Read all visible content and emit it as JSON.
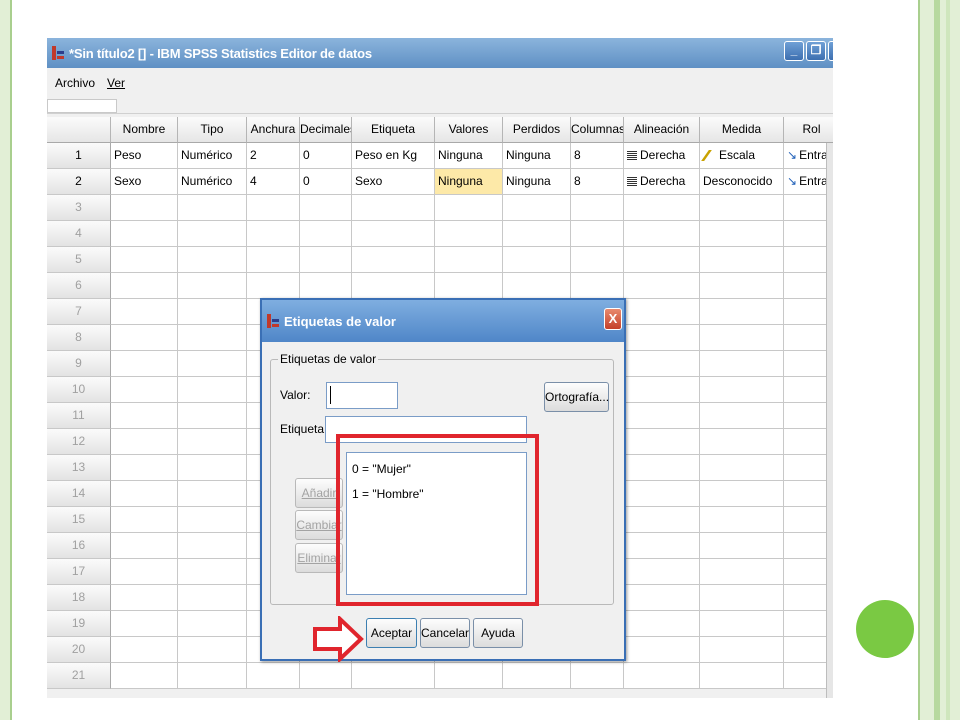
{
  "window": {
    "title": "*Sin título2 [] - IBM SPSS Statistics Editor de datos",
    "minimize_glyph": "_",
    "restore_glyph": "❐",
    "close_glyph": "X"
  },
  "menu": {
    "items": [
      "Archivo",
      "Ver"
    ]
  },
  "grid": {
    "columns": [
      "",
      "Nombre",
      "Tipo",
      "Anchura",
      "Decimales",
      "Etiqueta",
      "Valores",
      "Perdidos",
      "Columnas",
      "Alineación",
      "Medida",
      "Rol"
    ],
    "rows": [
      {
        "num": "1",
        "cells": [
          "Peso",
          "Numérico",
          "2",
          "0",
          "Peso en Kg",
          "Ninguna",
          "Ninguna",
          "8",
          "Derecha",
          "Escala",
          "Entra"
        ]
      },
      {
        "num": "2",
        "cells": [
          "Sexo",
          "Numérico",
          "4",
          "0",
          "Sexo",
          "Ninguna",
          "Ninguna",
          "8",
          "Derecha",
          "Desconocido",
          "Entra"
        ]
      }
    ],
    "empty_rows": [
      "3",
      "4",
      "5",
      "6",
      "7",
      "8",
      "9",
      "10",
      "11",
      "12",
      "13",
      "14",
      "15",
      "16",
      "17",
      "18",
      "19",
      "20",
      "21"
    ]
  },
  "dialog": {
    "title": "Etiquetas de valor",
    "group_label": "Etiquetas de valor",
    "valor_label": "Valor:",
    "etiqueta_label": "Etiqueta:",
    "spelling_button": "Ortografía...",
    "add_button": "Añadir",
    "change_button": "Cambiar",
    "remove_button": "Eliminar",
    "value_list": [
      "0 = \"Mujer\"",
      "1 = \"Hombre\""
    ],
    "ok_button": "Aceptar",
    "cancel_button": "Cancelar",
    "help_button": "Ayuda",
    "close_glyph": "X"
  },
  "colors": {
    "annotation_red": "#e0252d",
    "accent_green": "#7ac943",
    "highlight_cell": "#fde9a8"
  }
}
